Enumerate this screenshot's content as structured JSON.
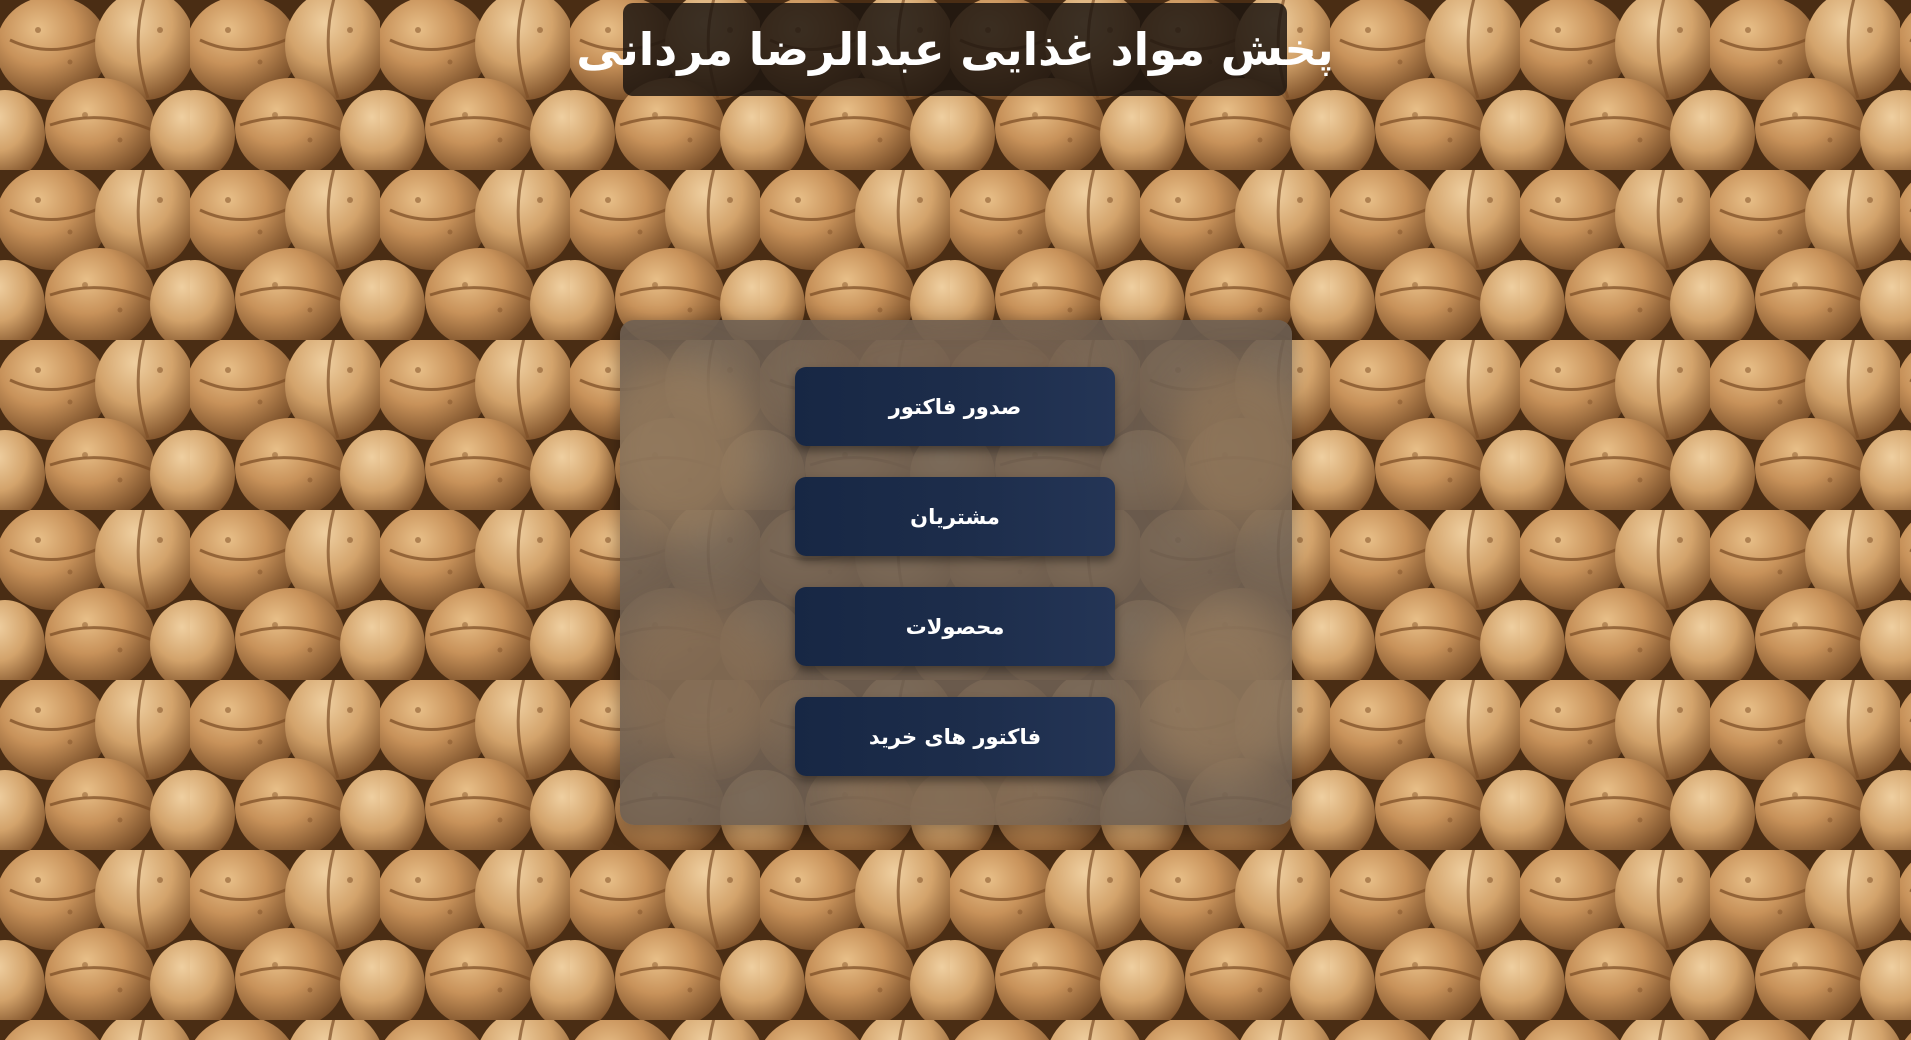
{
  "header": {
    "title": "پخش مواد غذایی عبدالرضا مردانی"
  },
  "menu": {
    "items": [
      {
        "label": "صدور فاکتور"
      },
      {
        "label": "مشتریان"
      },
      {
        "label": "محصولات"
      },
      {
        "label": "فاکتور های خرید"
      }
    ]
  },
  "colors": {
    "button_bg": "#1d2d4b",
    "button_text": "#ffffff",
    "title_bg": "#1e1610",
    "panel_bg": "#6e5f52"
  },
  "background": {
    "image": "walnuts-photo"
  }
}
